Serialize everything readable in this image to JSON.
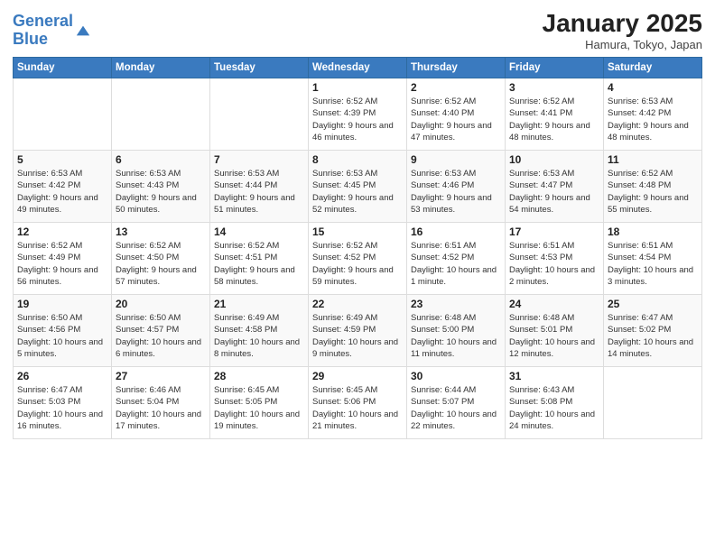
{
  "header": {
    "logo_line1": "General",
    "logo_line2": "Blue",
    "month": "January 2025",
    "location": "Hamura, Tokyo, Japan"
  },
  "weekdays": [
    "Sunday",
    "Monday",
    "Tuesday",
    "Wednesday",
    "Thursday",
    "Friday",
    "Saturday"
  ],
  "weeks": [
    [
      {
        "day": "",
        "info": ""
      },
      {
        "day": "",
        "info": ""
      },
      {
        "day": "",
        "info": ""
      },
      {
        "day": "1",
        "info": "Sunrise: 6:52 AM\nSunset: 4:39 PM\nDaylight: 9 hours\nand 46 minutes."
      },
      {
        "day": "2",
        "info": "Sunrise: 6:52 AM\nSunset: 4:40 PM\nDaylight: 9 hours\nand 47 minutes."
      },
      {
        "day": "3",
        "info": "Sunrise: 6:52 AM\nSunset: 4:41 PM\nDaylight: 9 hours\nand 48 minutes."
      },
      {
        "day": "4",
        "info": "Sunrise: 6:53 AM\nSunset: 4:42 PM\nDaylight: 9 hours\nand 48 minutes."
      }
    ],
    [
      {
        "day": "5",
        "info": "Sunrise: 6:53 AM\nSunset: 4:42 PM\nDaylight: 9 hours\nand 49 minutes."
      },
      {
        "day": "6",
        "info": "Sunrise: 6:53 AM\nSunset: 4:43 PM\nDaylight: 9 hours\nand 50 minutes."
      },
      {
        "day": "7",
        "info": "Sunrise: 6:53 AM\nSunset: 4:44 PM\nDaylight: 9 hours\nand 51 minutes."
      },
      {
        "day": "8",
        "info": "Sunrise: 6:53 AM\nSunset: 4:45 PM\nDaylight: 9 hours\nand 52 minutes."
      },
      {
        "day": "9",
        "info": "Sunrise: 6:53 AM\nSunset: 4:46 PM\nDaylight: 9 hours\nand 53 minutes."
      },
      {
        "day": "10",
        "info": "Sunrise: 6:53 AM\nSunset: 4:47 PM\nDaylight: 9 hours\nand 54 minutes."
      },
      {
        "day": "11",
        "info": "Sunrise: 6:52 AM\nSunset: 4:48 PM\nDaylight: 9 hours\nand 55 minutes."
      }
    ],
    [
      {
        "day": "12",
        "info": "Sunrise: 6:52 AM\nSunset: 4:49 PM\nDaylight: 9 hours\nand 56 minutes."
      },
      {
        "day": "13",
        "info": "Sunrise: 6:52 AM\nSunset: 4:50 PM\nDaylight: 9 hours\nand 57 minutes."
      },
      {
        "day": "14",
        "info": "Sunrise: 6:52 AM\nSunset: 4:51 PM\nDaylight: 9 hours\nand 58 minutes."
      },
      {
        "day": "15",
        "info": "Sunrise: 6:52 AM\nSunset: 4:52 PM\nDaylight: 9 hours\nand 59 minutes."
      },
      {
        "day": "16",
        "info": "Sunrise: 6:51 AM\nSunset: 4:52 PM\nDaylight: 10 hours\nand 1 minute."
      },
      {
        "day": "17",
        "info": "Sunrise: 6:51 AM\nSunset: 4:53 PM\nDaylight: 10 hours\nand 2 minutes."
      },
      {
        "day": "18",
        "info": "Sunrise: 6:51 AM\nSunset: 4:54 PM\nDaylight: 10 hours\nand 3 minutes."
      }
    ],
    [
      {
        "day": "19",
        "info": "Sunrise: 6:50 AM\nSunset: 4:56 PM\nDaylight: 10 hours\nand 5 minutes."
      },
      {
        "day": "20",
        "info": "Sunrise: 6:50 AM\nSunset: 4:57 PM\nDaylight: 10 hours\nand 6 minutes."
      },
      {
        "day": "21",
        "info": "Sunrise: 6:49 AM\nSunset: 4:58 PM\nDaylight: 10 hours\nand 8 minutes."
      },
      {
        "day": "22",
        "info": "Sunrise: 6:49 AM\nSunset: 4:59 PM\nDaylight: 10 hours\nand 9 minutes."
      },
      {
        "day": "23",
        "info": "Sunrise: 6:48 AM\nSunset: 5:00 PM\nDaylight: 10 hours\nand 11 minutes."
      },
      {
        "day": "24",
        "info": "Sunrise: 6:48 AM\nSunset: 5:01 PM\nDaylight: 10 hours\nand 12 minutes."
      },
      {
        "day": "25",
        "info": "Sunrise: 6:47 AM\nSunset: 5:02 PM\nDaylight: 10 hours\nand 14 minutes."
      }
    ],
    [
      {
        "day": "26",
        "info": "Sunrise: 6:47 AM\nSunset: 5:03 PM\nDaylight: 10 hours\nand 16 minutes."
      },
      {
        "day": "27",
        "info": "Sunrise: 6:46 AM\nSunset: 5:04 PM\nDaylight: 10 hours\nand 17 minutes."
      },
      {
        "day": "28",
        "info": "Sunrise: 6:45 AM\nSunset: 5:05 PM\nDaylight: 10 hours\nand 19 minutes."
      },
      {
        "day": "29",
        "info": "Sunrise: 6:45 AM\nSunset: 5:06 PM\nDaylight: 10 hours\nand 21 minutes."
      },
      {
        "day": "30",
        "info": "Sunrise: 6:44 AM\nSunset: 5:07 PM\nDaylight: 10 hours\nand 22 minutes."
      },
      {
        "day": "31",
        "info": "Sunrise: 6:43 AM\nSunset: 5:08 PM\nDaylight: 10 hours\nand 24 minutes."
      },
      {
        "day": "",
        "info": ""
      }
    ]
  ]
}
